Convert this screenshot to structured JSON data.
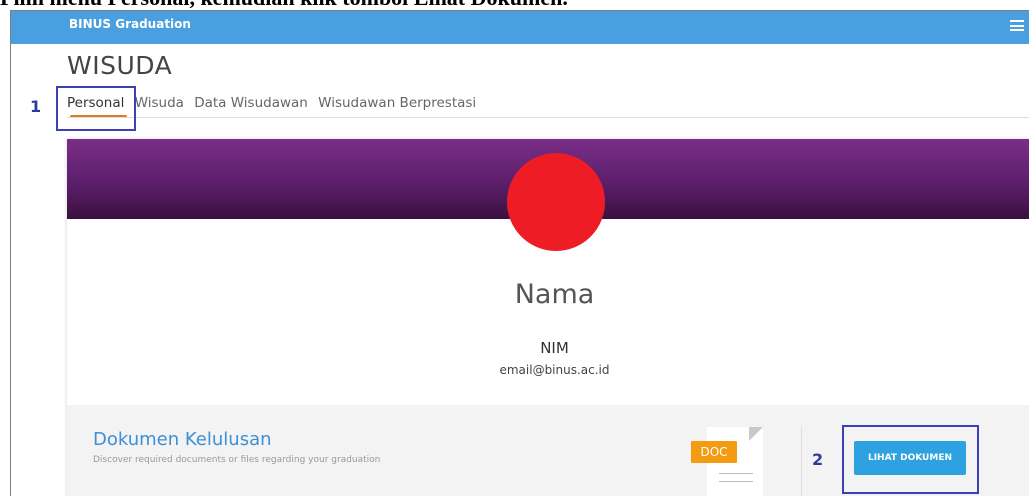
{
  "caption": "Pilih menu Personal, kemudian klik tombol Lihat Dokumen.",
  "topbar": {
    "brand": "BINUS Graduation",
    "menu_icon": "hamburger-menu-icon"
  },
  "page_title": "WISUDA",
  "tabs": [
    {
      "label": "Personal",
      "active": true
    },
    {
      "label": "Wisuda"
    },
    {
      "label": "Data Wisudawan"
    },
    {
      "label": "Wisudawan Berprestasi"
    }
  ],
  "profile": {
    "name": "Nama",
    "nim": "NIM",
    "email": "email@binus.ac.id"
  },
  "documents": {
    "title": "Dokumen Kelulusan",
    "subtitle": "Discover required documents or files regarding your graduation",
    "doc_badge": "DOC",
    "button": "LIHAT DOKUMEN"
  },
  "annotations": [
    {
      "number": "1"
    },
    {
      "number": "2"
    }
  ],
  "colors": {
    "topbar": "#4a9fe0",
    "accent": "#e07b22",
    "banner": "#6b2477",
    "avatar": "#ee1c24",
    "button": "#2ea2e0",
    "annotation": "#3b3fb8"
  }
}
